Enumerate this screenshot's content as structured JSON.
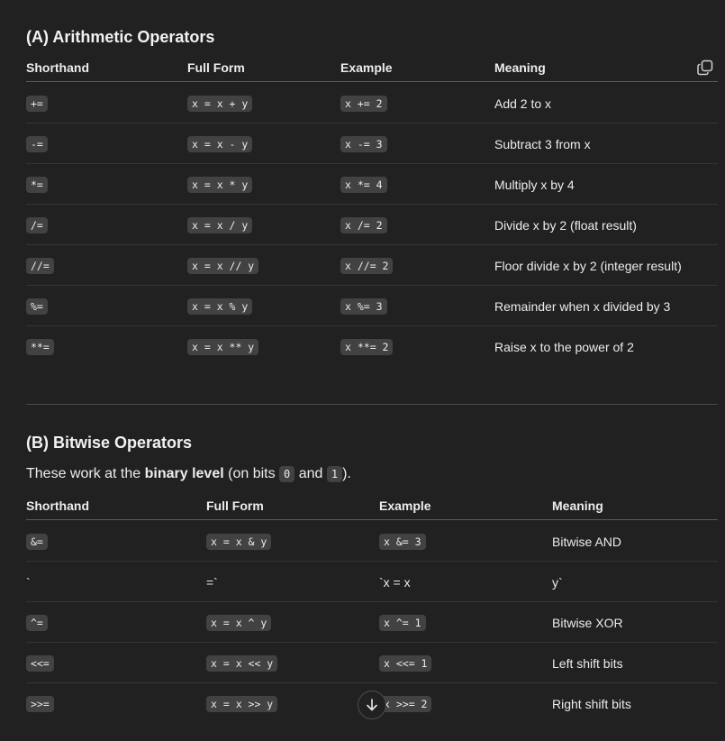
{
  "arithmetic": {
    "title": "(A) Arithmetic Operators",
    "headers": [
      "Shorthand",
      "Full Form",
      "Example",
      "Meaning"
    ],
    "copy_icon": "copy-icon",
    "rows": [
      {
        "shorthand": "+=",
        "full": "x = x + y",
        "example": "x += 2",
        "meaning": "Add 2 to x"
      },
      {
        "shorthand": "-=",
        "full": "x = x - y",
        "example": "x -= 3",
        "meaning": "Subtract 3 from x"
      },
      {
        "shorthand": "*=",
        "full": "x = x * y",
        "example": "x *= 4",
        "meaning": "Multiply x by 4"
      },
      {
        "shorthand": "/=",
        "full": "x = x / y",
        "example": "x /= 2",
        "meaning": "Divide x by 2 (float result)"
      },
      {
        "shorthand": "//=",
        "full": "x = x // y",
        "example": "x //= 2",
        "meaning": "Floor divide x by 2 (integer result)"
      },
      {
        "shorthand": "%=",
        "full": "x = x % y",
        "example": "x %= 3",
        "meaning": "Remainder when x divided by 3"
      },
      {
        "shorthand": "**=",
        "full": "x = x ** y",
        "example": "x **= 2",
        "meaning": "Raise x to the power of 2"
      }
    ]
  },
  "bitwise": {
    "title": "(B) Bitwise Operators",
    "intro_prefix": "These work at the ",
    "intro_bold": "binary level",
    "intro_mid": " (on bits ",
    "intro_bit0": "0",
    "intro_and": " and ",
    "intro_bit1": "1",
    "intro_suffix": ").",
    "headers": [
      "Shorthand",
      "Full Form",
      "Example",
      "Meaning"
    ],
    "rows": [
      {
        "shorthand": "&=",
        "full": "x = x & y",
        "example": "x &= 3",
        "meaning": "Bitwise AND",
        "plain": false
      },
      {
        "shorthand": "`",
        "full": "=`",
        "example": "`x = x",
        "meaning": "y`",
        "plain": true
      },
      {
        "shorthand": "^=",
        "full": "x = x ^ y",
        "example": "x ^= 1",
        "meaning": "Bitwise XOR",
        "plain": false
      },
      {
        "shorthand": "<<=",
        "full": "x = x << y",
        "example": "x <<= 1",
        "meaning": "Left shift bits",
        "plain": false
      },
      {
        "shorthand": ">>=",
        "full": "x = x >> y",
        "example": "x >>= 2",
        "meaning": "Right shift bits",
        "plain": false
      }
    ]
  },
  "scroll_button_icon": "arrow-down-icon"
}
